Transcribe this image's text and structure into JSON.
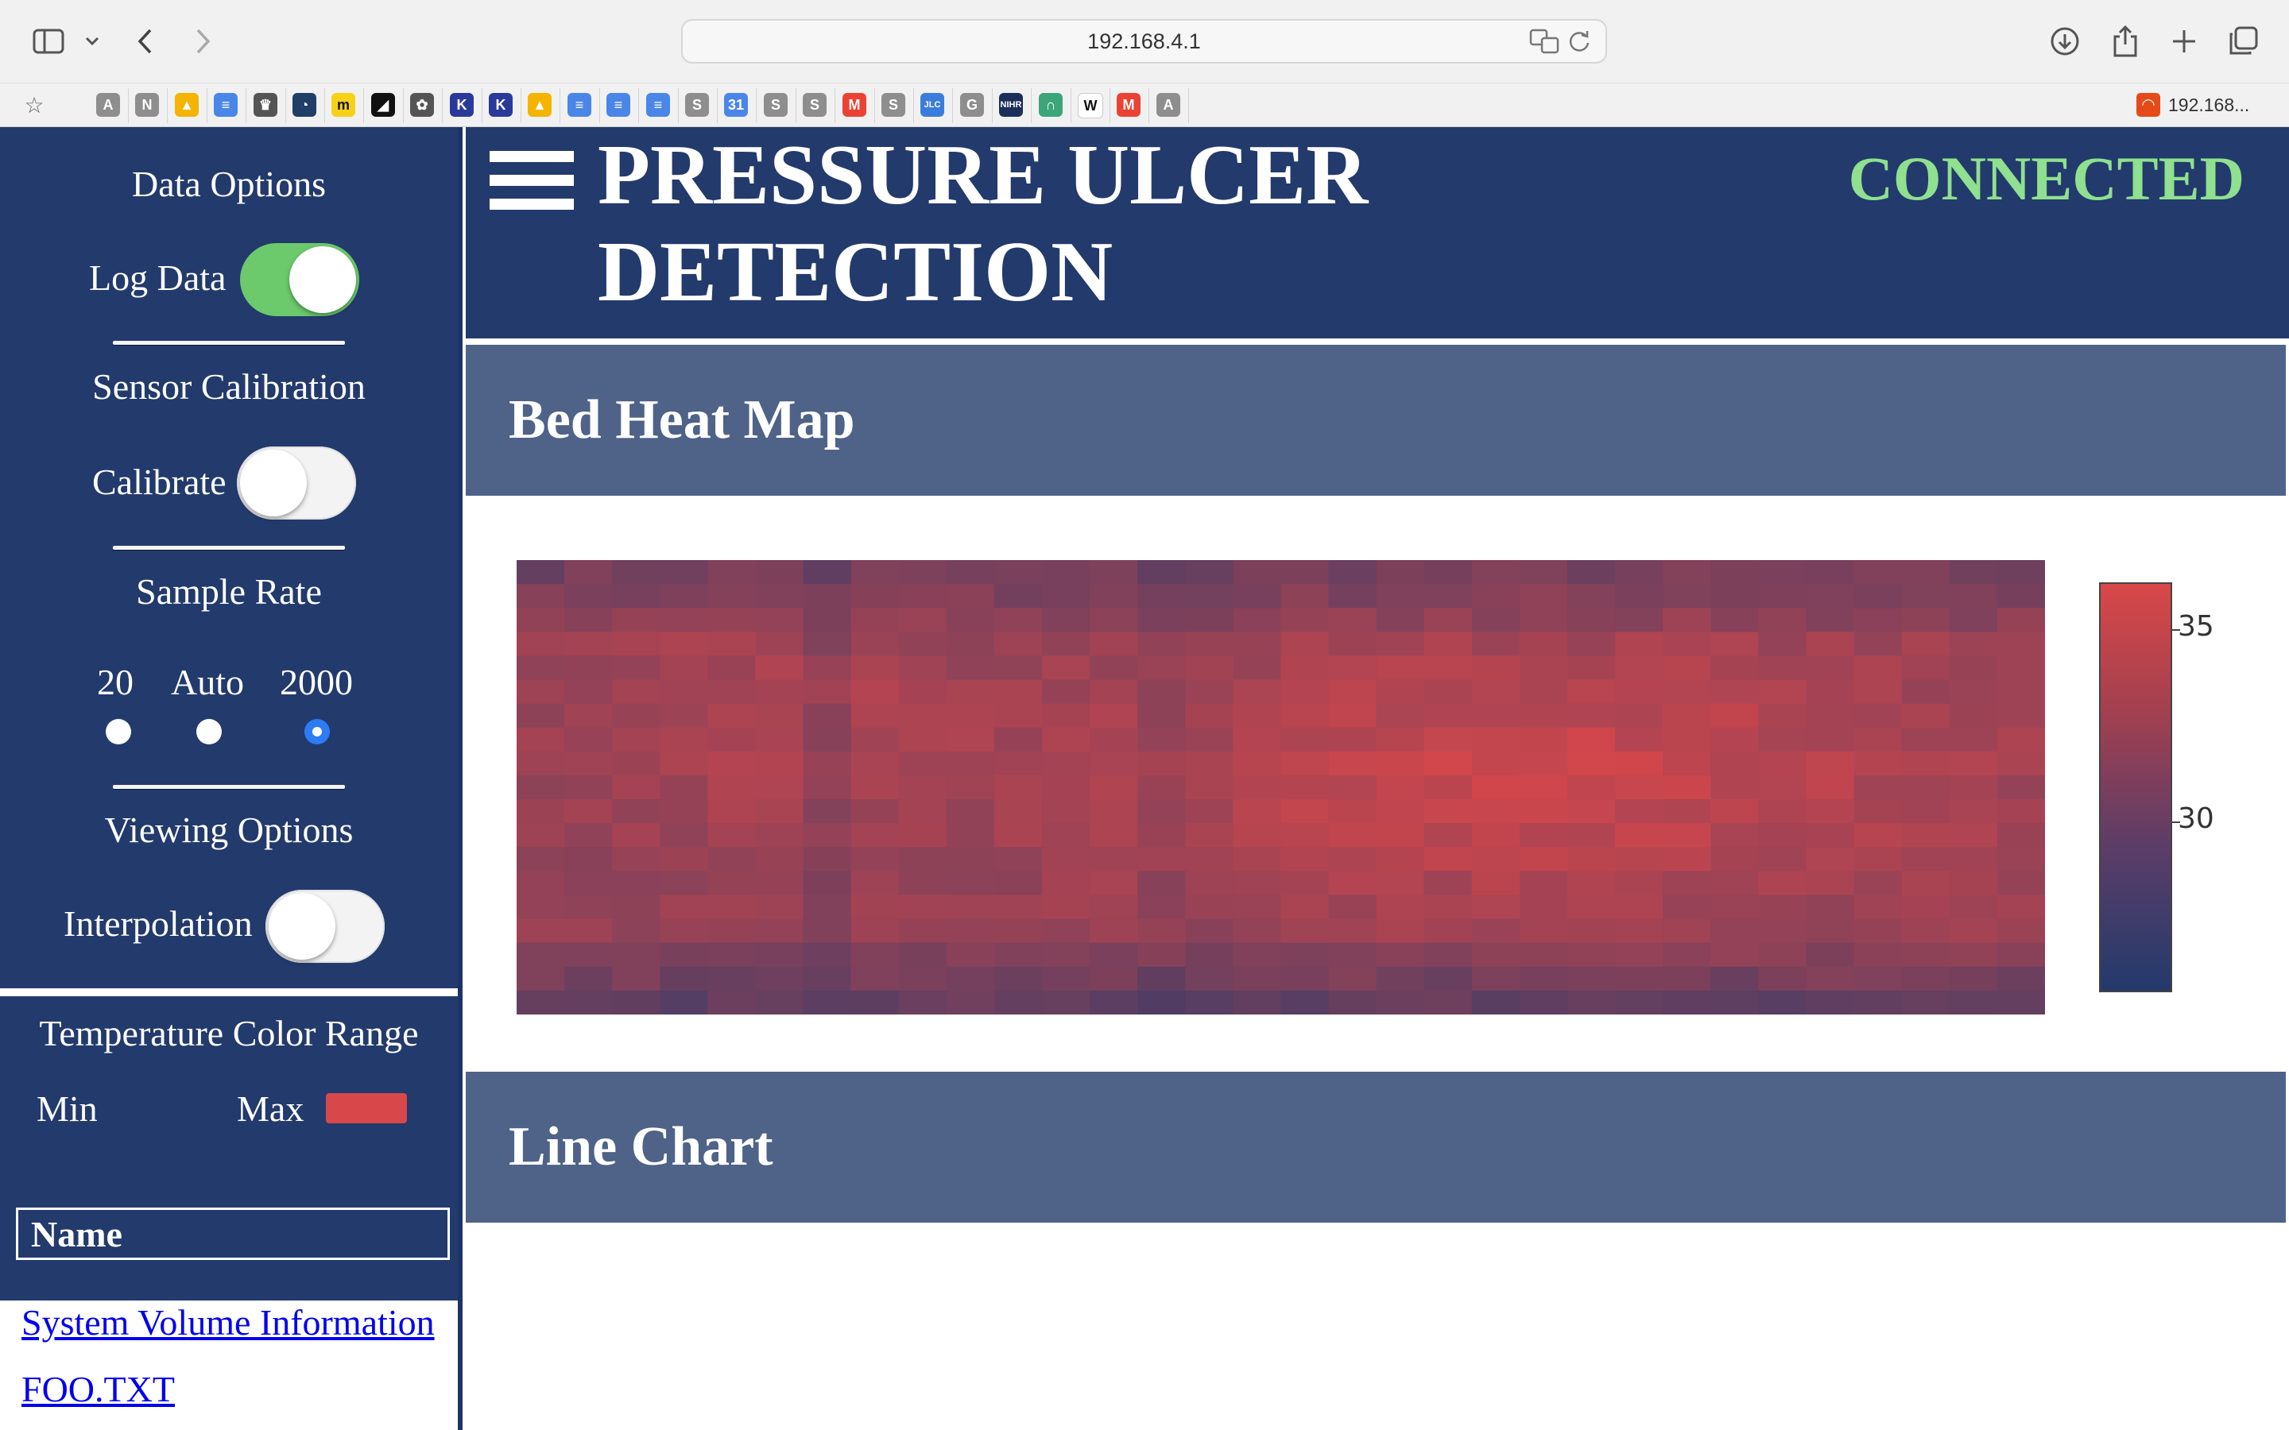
{
  "browser": {
    "url": "192.168.4.1",
    "bookmarks": [
      {
        "letter": "A",
        "color": "#8e8e8e"
      },
      {
        "letter": "N",
        "color": "#8e8e8e"
      },
      {
        "letter": "▲",
        "color": "#f4b400"
      },
      {
        "letter": "≡",
        "color": "#4a86e8"
      },
      {
        "letter": "♛",
        "color": "#555555"
      },
      {
        "letter": "◔",
        "color": "#1f3f66"
      },
      {
        "letter": "m",
        "color": "#f7d117"
      },
      {
        "letter": "◢",
        "color": "#111111"
      },
      {
        "letter": "✿",
        "color": "#555555"
      },
      {
        "letter": "K",
        "color": "#2a3a9a"
      },
      {
        "letter": "K",
        "color": "#2a3a9a"
      },
      {
        "letter": "▲",
        "color": "#f4b400"
      },
      {
        "letter": "≡",
        "color": "#4a86e8"
      },
      {
        "letter": "≡",
        "color": "#4a86e8"
      },
      {
        "letter": "≡",
        "color": "#4a86e8"
      },
      {
        "letter": "S",
        "color": "#8e8e8e"
      },
      {
        "letter": "31",
        "color": "#4a86e8"
      },
      {
        "letter": "S",
        "color": "#8e8e8e"
      },
      {
        "letter": "S",
        "color": "#8e8e8e"
      },
      {
        "letter": "M",
        "color": "#ea4335"
      },
      {
        "letter": "S",
        "color": "#8e8e8e"
      },
      {
        "letter": "JLC",
        "color": "#3b7ddd"
      },
      {
        "letter": "G",
        "color": "#8e8e8e"
      },
      {
        "letter": "NIHR",
        "color": "#1c2f5a"
      },
      {
        "letter": "∩",
        "color": "#3aa67a"
      },
      {
        "letter": "W",
        "color": "#ffffff"
      },
      {
        "letter": "M",
        "color": "#ea4335"
      },
      {
        "letter": "A",
        "color": "#8e8e8e"
      }
    ],
    "last_bookmark": "192.168..."
  },
  "sidebar": {
    "data_options_heading": "Data Options",
    "log_data_label": "Log Data",
    "log_data_on": true,
    "sensor_calibration_heading": "Sensor Calibration",
    "calibrate_label": "Calibrate",
    "calibrate_on": false,
    "sample_rate_heading": "Sample Rate",
    "sample_rates": [
      "20",
      "Auto",
      "2000"
    ],
    "sample_rate_selected": "2000",
    "viewing_options_heading": "Viewing Options",
    "interpolation_label": "Interpolation",
    "interpolation_on": false,
    "color_range_heading": "Temperature Color Range",
    "min_label": "Min",
    "max_label": "Max",
    "min_color": "#233a6c",
    "max_color": "#d8474a",
    "file_table_header": "Name",
    "files": [
      "System Volume Information",
      "FOO.TXT"
    ]
  },
  "header": {
    "title_line1": "PRESSURE ULCER",
    "title_line2": "DETECTION",
    "status": "CONNECTED",
    "status_color": "#8fe08f"
  },
  "sections": {
    "heatmap_title": "Bed Heat Map",
    "linechart_title": "Line Chart"
  },
  "heatmap": {
    "colorbar_ticks": [
      "35",
      "30"
    ],
    "color_scale": [
      "#233a6c",
      "#d8474a"
    ],
    "rows": 19,
    "cols": 32
  }
}
